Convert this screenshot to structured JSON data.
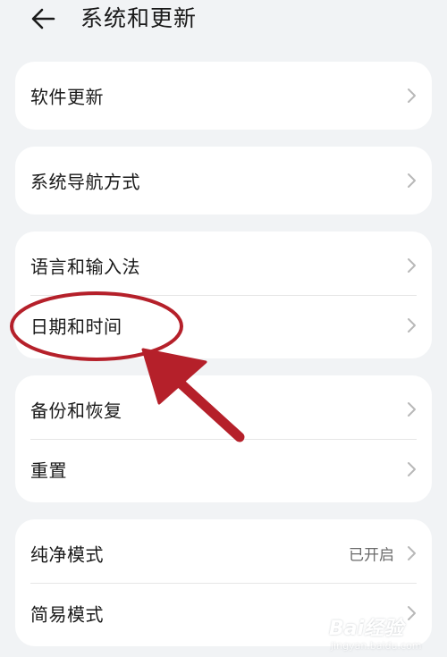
{
  "header": {
    "title": "系统和更新",
    "back_icon": "arrow-left-icon"
  },
  "groups": [
    {
      "items": [
        {
          "label": "软件更新",
          "value": ""
        }
      ]
    },
    {
      "items": [
        {
          "label": "系统导航方式",
          "value": ""
        }
      ]
    },
    {
      "items": [
        {
          "label": "语言和输入法",
          "value": ""
        },
        {
          "label": "日期和时间",
          "value": ""
        }
      ]
    },
    {
      "items": [
        {
          "label": "备份和恢复",
          "value": ""
        },
        {
          "label": "重置",
          "value": ""
        }
      ]
    },
    {
      "items": [
        {
          "label": "纯净模式",
          "value": "已开启"
        },
        {
          "label": "简易模式",
          "value": ""
        }
      ]
    }
  ],
  "annotation": {
    "color": "#b5202a",
    "highlighted_item": "日期和时间"
  },
  "watermark": {
    "text": "Bai经验",
    "url": "jingyan.baidu.com"
  }
}
